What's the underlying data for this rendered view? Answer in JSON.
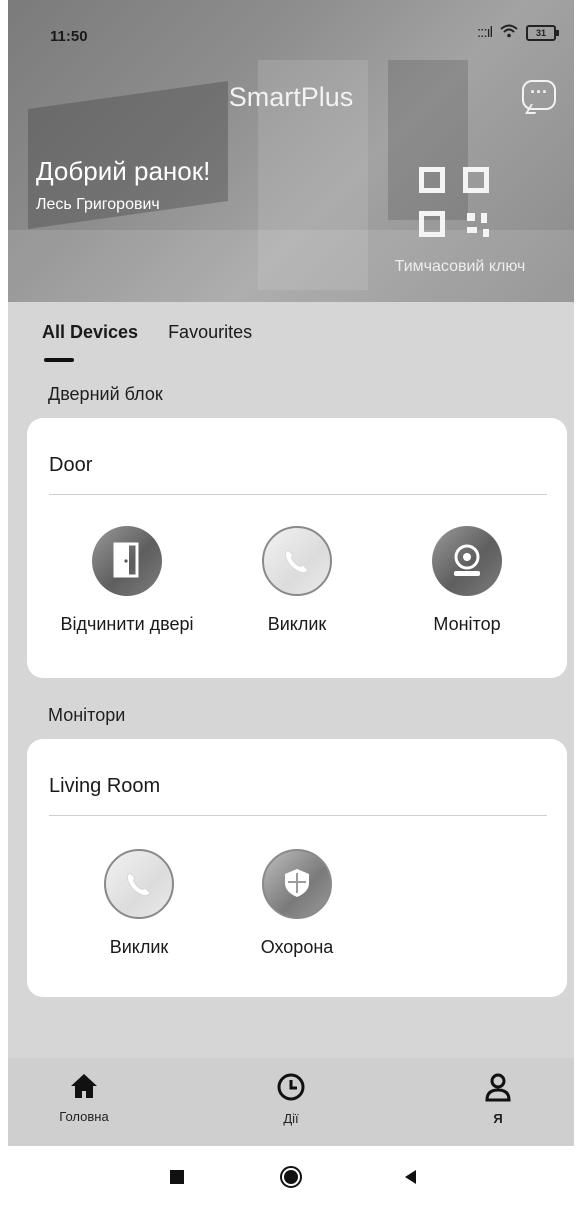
{
  "status_bar": {
    "time": "11:50",
    "signal": ":::ıl",
    "battery": "31"
  },
  "header": {
    "title": "SmartPlus",
    "greeting": "Добрий ранок!",
    "user_name": "Лесь Григорович",
    "temp_key_label": "Тимчасовий ключ",
    "message_icon": "chat-bubble-icon",
    "qr_icon": "qr-code-icon"
  },
  "tabs": [
    {
      "label": "All Devices",
      "active": true
    },
    {
      "label": "Favourites",
      "active": false
    }
  ],
  "sections": [
    {
      "label": "Дверний блок",
      "card_title": "Door",
      "actions": [
        {
          "label": "Відчинити двері",
          "icon": "door-icon"
        },
        {
          "label": "Виклик",
          "icon": "phone-icon"
        },
        {
          "label": "Монітор",
          "icon": "camera-icon"
        }
      ]
    },
    {
      "label": "Монітори",
      "card_title": "Living Room",
      "actions": [
        {
          "label": "Виклик",
          "icon": "phone-icon"
        },
        {
          "label": "Охорона",
          "icon": "shield-icon"
        }
      ]
    }
  ],
  "bottom_nav": [
    {
      "label": "Головна",
      "icon": "home-icon",
      "active": true
    },
    {
      "label": "Дії",
      "icon": "clock-icon",
      "active": false
    },
    {
      "label": "Я",
      "icon": "user-icon",
      "active": false
    }
  ],
  "system_nav": {
    "icons": [
      "stop-icon",
      "home-circle-icon",
      "back-icon"
    ]
  }
}
